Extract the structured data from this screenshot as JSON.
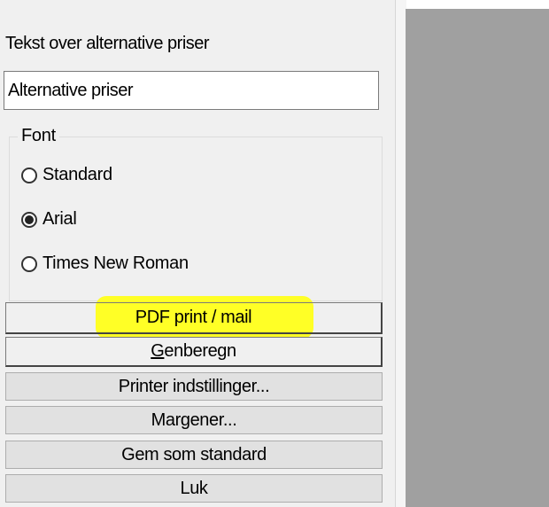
{
  "section_label": "Tekst over alternative priser",
  "alt_price_text": {
    "value": "Alternative priser"
  },
  "font_group": {
    "title": "Font",
    "options": [
      {
        "label": "Standard",
        "selected": false
      },
      {
        "label": "Arial",
        "selected": true
      },
      {
        "label": "Times New Roman",
        "selected": false
      }
    ]
  },
  "buttons": {
    "pdf": "PDF print / mail",
    "recalc_first": "G",
    "recalc_rest": "enberegn",
    "printer": "Printer indstillinger...",
    "margins": "Margener...",
    "save_default": "Gem som standard",
    "close": "Luk"
  },
  "colors": {
    "panel": "#f0f0f0",
    "right_area": "#a0a0a0",
    "highlight": "#ffff1a"
  }
}
